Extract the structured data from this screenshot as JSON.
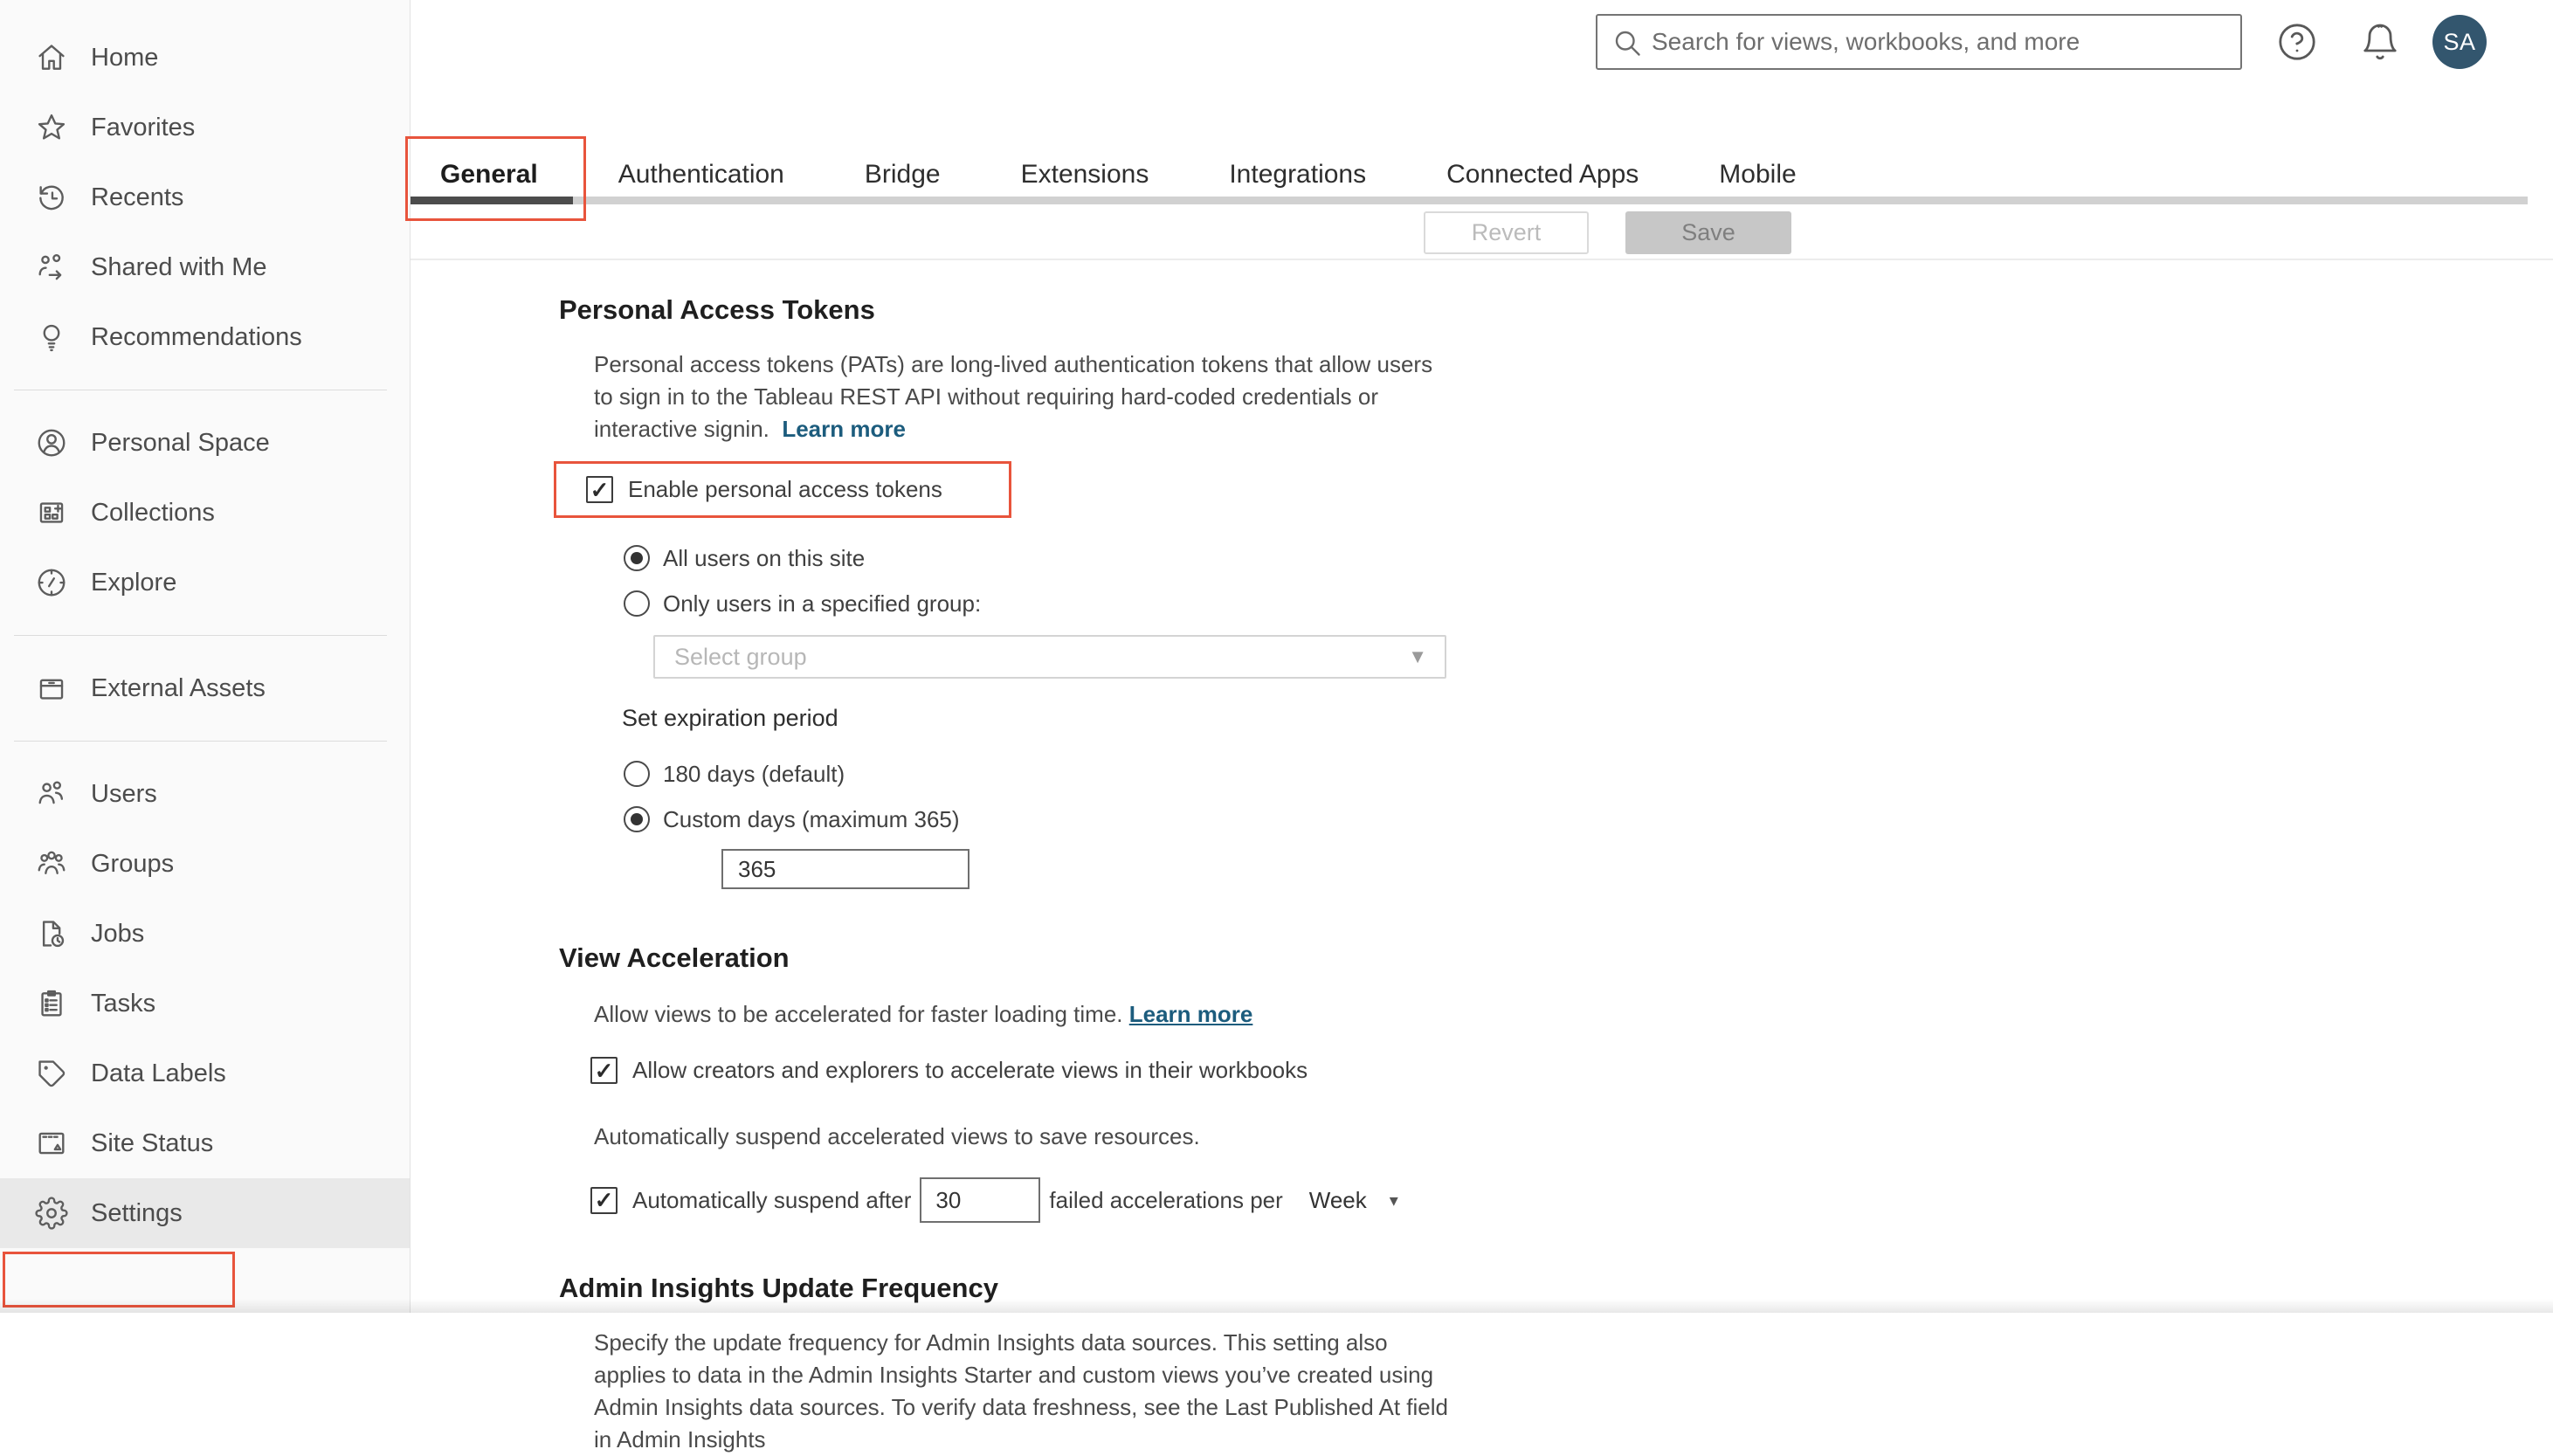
{
  "ui": {
    "checkmark": "✓",
    "caret_down": "▼",
    "caret_small": "▾"
  },
  "colors": {
    "accent_red": "#e8543c",
    "link_blue": "#1c5c7d",
    "avatar_bg": "#33566e",
    "active_tab_bar": "#4c4c4c"
  },
  "topbar": {
    "search_placeholder": "Search for views, workbooks, and more",
    "avatar_initials": "SA"
  },
  "sidebar": {
    "groups": [
      {
        "items": [
          {
            "label": "Home",
            "icon": "home-icon"
          },
          {
            "label": "Favorites",
            "icon": "star-icon"
          },
          {
            "label": "Recents",
            "icon": "history-icon"
          },
          {
            "label": "Shared with Me",
            "icon": "shared-icon"
          },
          {
            "label": "Recommendations",
            "icon": "lightbulb-icon"
          }
        ]
      },
      {
        "items": [
          {
            "label": "Personal Space",
            "icon": "person-circle-icon"
          },
          {
            "label": "Collections",
            "icon": "collections-icon"
          },
          {
            "label": "Explore",
            "icon": "compass-icon"
          }
        ]
      },
      {
        "items": [
          {
            "label": "External Assets",
            "icon": "drawer-icon"
          }
        ]
      },
      {
        "items": [
          {
            "label": "Users",
            "icon": "users-icon"
          },
          {
            "label": "Groups",
            "icon": "groups-icon"
          },
          {
            "label": "Jobs",
            "icon": "jobs-icon"
          },
          {
            "label": "Tasks",
            "icon": "tasks-icon"
          },
          {
            "label": "Data Labels",
            "icon": "tag-icon"
          },
          {
            "label": "Site Status",
            "icon": "site-status-icon"
          },
          {
            "label": "Settings",
            "icon": "gear-icon",
            "active": true,
            "highlighted": true
          }
        ]
      }
    ]
  },
  "tabs": {
    "items": [
      {
        "label": "General",
        "active": true,
        "highlighted": true
      },
      {
        "label": "Authentication"
      },
      {
        "label": "Bridge"
      },
      {
        "label": "Extensions"
      },
      {
        "label": "Integrations"
      },
      {
        "label": "Connected Apps"
      },
      {
        "label": "Mobile"
      }
    ]
  },
  "actions": {
    "revert_label": "Revert",
    "save_label": "Save"
  },
  "sections": {
    "pat": {
      "title": "Personal Access Tokens",
      "description": "Personal access tokens (PATs) are long-lived authentication tokens that allow users to sign in to the Tableau REST API without requiring hard-coded credentials or interactive signin.",
      "learn_more": "Learn more",
      "enable_checkbox": {
        "label": "Enable personal access tokens",
        "checked": true,
        "highlighted": true
      },
      "radio_all_users": {
        "label": "All users on this site",
        "selected": true
      },
      "radio_group": {
        "label": "Only users in a specified group:",
        "selected": false
      },
      "group_select_placeholder": "Select group",
      "expiration_label": "Set expiration period",
      "radio_180": {
        "label": "180 days (default)",
        "selected": false
      },
      "radio_custom": {
        "label": "Custom days (maximum 365)",
        "selected": true
      },
      "custom_days_value": "365"
    },
    "view_acceleration": {
      "title": "View Acceleration",
      "description": "Allow views to be accelerated for faster loading time.",
      "learn_more": "Learn more",
      "allow_checkbox": {
        "label": "Allow creators and explorers to accelerate views in their workbooks",
        "checked": true
      },
      "suspend_description": "Automatically suspend accelerated views to save resources.",
      "suspend_checkbox": {
        "checked": true,
        "label_before": "Automatically suspend after",
        "value": "30",
        "label_after": "failed accelerations per",
        "period": "Week"
      }
    },
    "admin_insights": {
      "title": "Admin Insights Update Frequency",
      "description": "Specify the update frequency for Admin Insights data sources. This setting also applies to data in the Admin Insights Starter and custom views you’ve created using Admin Insights data sources. To verify data freshness, see the Last Published At field in Admin Insights"
    }
  }
}
